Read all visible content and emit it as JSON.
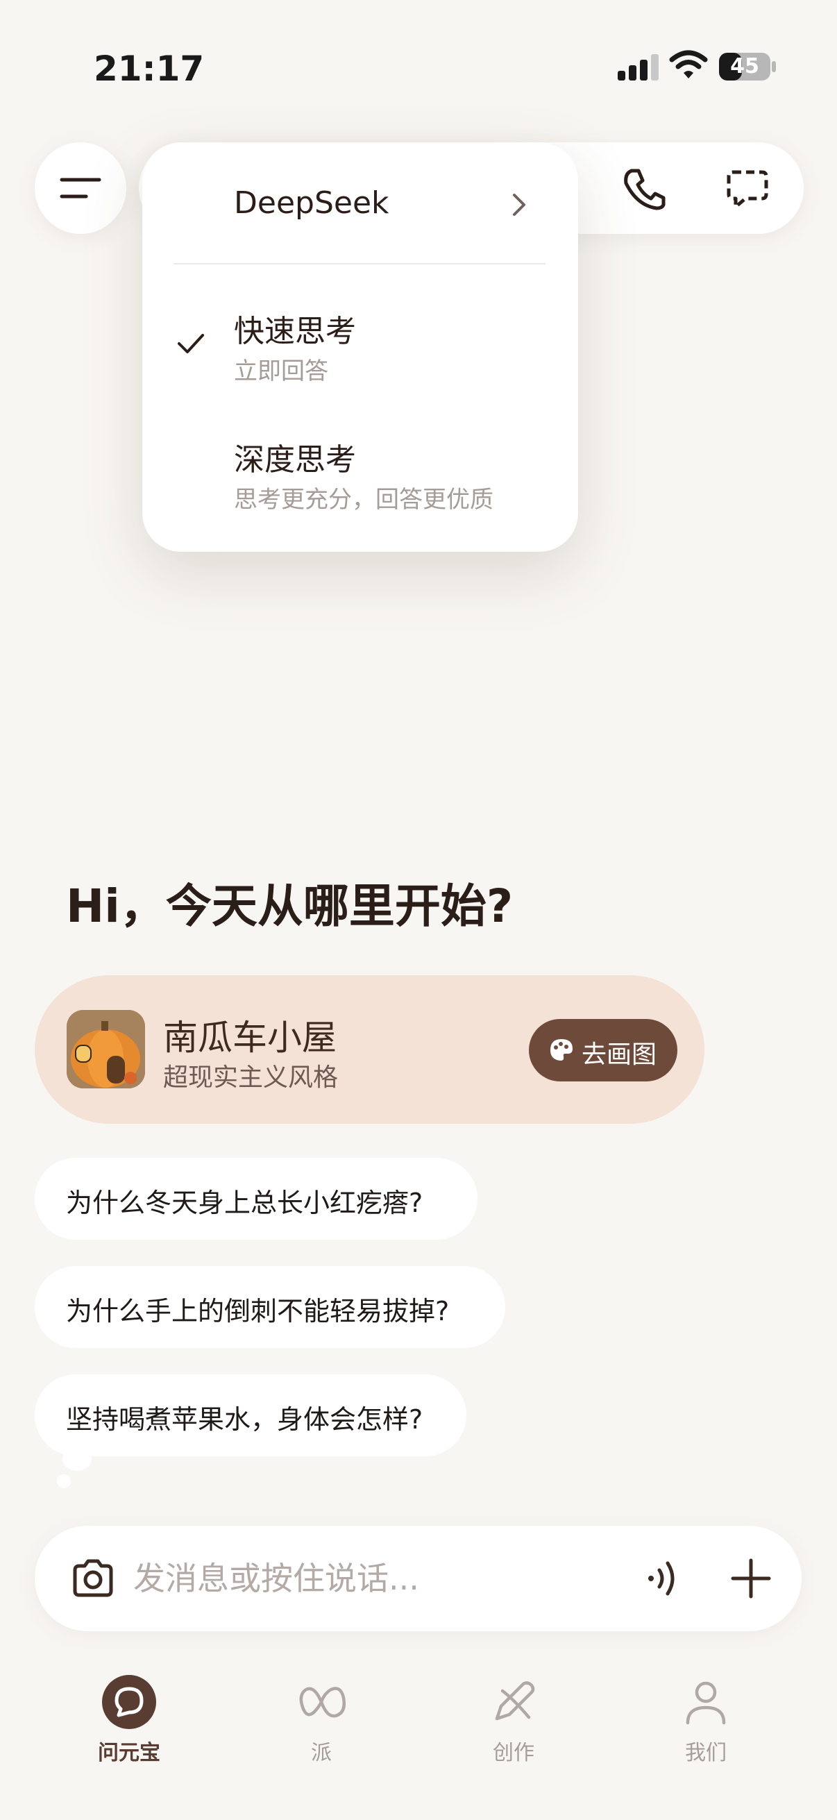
{
  "status_bar": {
    "time": "21:17",
    "battery": "45",
    "battery_level": 0.45
  },
  "model_menu": {
    "model": "DeepSeek",
    "options": [
      {
        "title": "快速思考",
        "subtitle": "立即回答",
        "selected": true
      },
      {
        "title": "深度思考",
        "subtitle": "思考更充分，回答更优质",
        "selected": false
      }
    ]
  },
  "greeting": "Hi，今天从哪里开始?",
  "promo": {
    "title": "南瓜车小屋",
    "subtitle": "超现实主义风格",
    "button_label": "去画图"
  },
  "suggestions": [
    "为什么冬天身上总长小红疙瘩?",
    "为什么手上的倒刺不能轻易拔掉?",
    "坚持喝煮苹果水，身体会怎样?"
  ],
  "input": {
    "placeholder": "发消息或按住说话..."
  },
  "bottom_nav": [
    {
      "label": "问元宝",
      "icon": "chat-bubble-icon",
      "active": true
    },
    {
      "label": "派",
      "icon": "infinity-icon",
      "active": false
    },
    {
      "label": "创作",
      "icon": "pen-sparkle-icon",
      "active": false
    },
    {
      "label": "我们",
      "icon": "person-icon",
      "active": false
    }
  ],
  "icons": {
    "menu": "hamburger-icon",
    "phone": "phone-icon",
    "new_chat": "new-chat-icon",
    "camera": "camera-icon",
    "voice": "voice-wave-icon",
    "plus": "plus-icon"
  },
  "colors": {
    "background": "#f8f6f3",
    "accent_dark": "#6d4a3a",
    "promo_bg": "#f4e2d7",
    "text": "#2b1d17"
  }
}
